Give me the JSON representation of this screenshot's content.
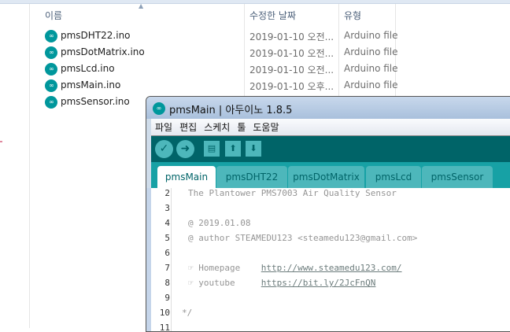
{
  "explorer": {
    "columns": {
      "name": "이름",
      "date": "수정한 날짜",
      "type": "유형"
    },
    "files": [
      {
        "name": "pmsDHT22.ino",
        "date": "2019-01-10 오전...",
        "type": "Arduino file"
      },
      {
        "name": "pmsDotMatrix.ino",
        "date": "2019-01-10 오전...",
        "type": "Arduino file"
      },
      {
        "name": "pmsLcd.ino",
        "date": "2019-01-10 오전...",
        "type": "Arduino file"
      },
      {
        "name": "pmsMain.ino",
        "date": "2019-01-10 오후...",
        "type": "Arduino file"
      },
      {
        "name": "pmsSensor.ino",
        "date": "",
        "type": ""
      }
    ]
  },
  "arduino": {
    "title": "pmsMain | 아두이노 1.8.5",
    "menu": [
      "파일",
      "편집",
      "스케치",
      "툴",
      "도움말"
    ],
    "tabs": [
      "pmsMain",
      "pmsDHT22",
      "pmsDotMatrix",
      "pmsLcd",
      "pmsSensor"
    ],
    "lines": [
      {
        "n": "2",
        "text": "The Plantower PMS7003 Air Quality Sensor",
        "link": ""
      },
      {
        "n": "3",
        "text": "",
        "link": ""
      },
      {
        "n": "4",
        "text": "@ 2019.01.08",
        "link": ""
      },
      {
        "n": "5",
        "text": "@ author STEAMEDU123 <steamedu123@gmail.com>",
        "link": ""
      },
      {
        "n": "6",
        "text": "",
        "link": ""
      },
      {
        "n": "7",
        "text": "☞ Homepage    ",
        "link": "http://www.steamedu123.com/"
      },
      {
        "n": "8",
        "text": "☞ youtube     ",
        "link": "https://bit.ly/2JcFnQN"
      },
      {
        "n": "9",
        "text": "",
        "link": ""
      },
      {
        "n": "10",
        "text": "*/",
        "link": ""
      },
      {
        "n": "11",
        "text": "",
        "link": ""
      }
    ]
  }
}
